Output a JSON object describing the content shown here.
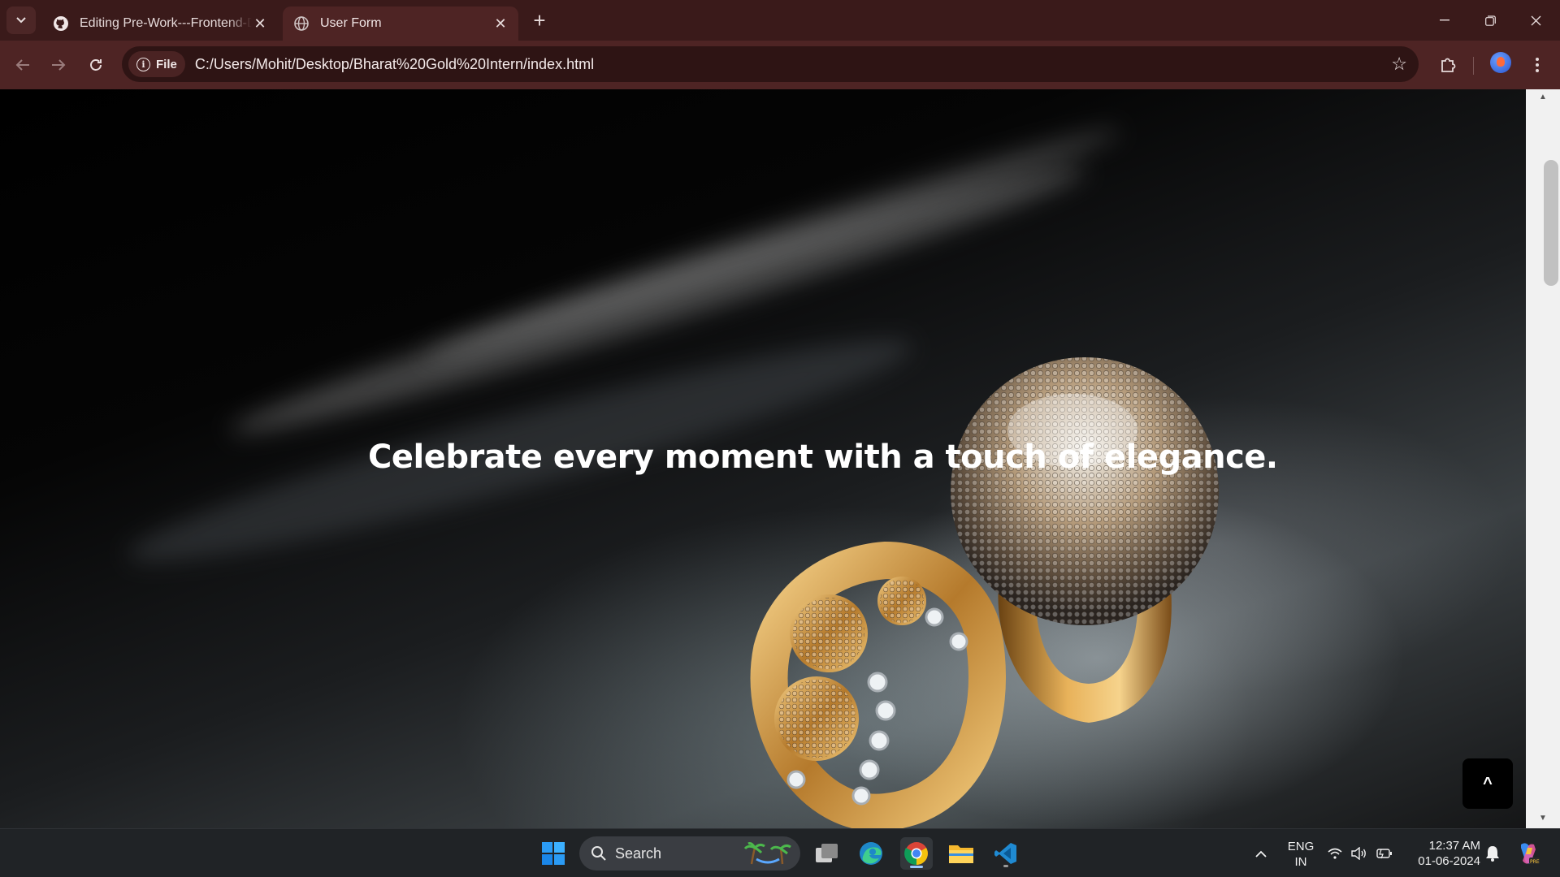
{
  "browser": {
    "tabs": [
      {
        "title": "Editing Pre-Work---Frontend-Developer",
        "icon": "github-icon",
        "active": false
      },
      {
        "title": "User Form",
        "icon": "globe-icon",
        "active": true
      }
    ],
    "site_chip": "File",
    "url": "C:/Users/Mohit/Desktop/Bharat%20Gold%20Intern/index.html"
  },
  "page": {
    "hero_title": "Celebrate every moment with a touch of elegance.",
    "scroll_top_label": "^"
  },
  "taskbar": {
    "search_placeholder": "Search",
    "apps": [
      "start-icon",
      "task-view-icon",
      "edge-icon",
      "chrome-icon",
      "file-explorer-icon",
      "vscode-icon"
    ],
    "language_line1": "ENG",
    "language_line2": "IN",
    "time": "12:37 AM",
    "date": "01-06-2024"
  }
}
